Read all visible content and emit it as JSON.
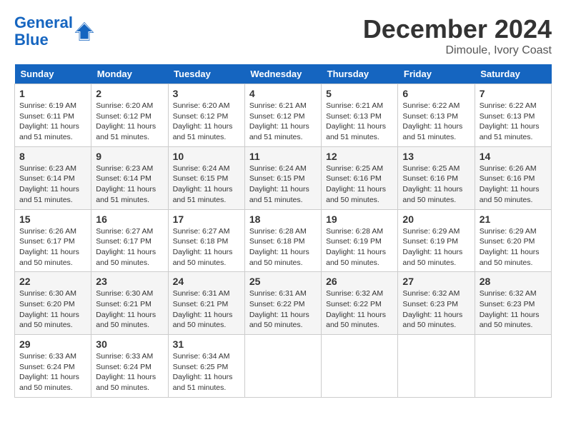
{
  "header": {
    "logo_line1": "General",
    "logo_line2": "Blue",
    "month": "December 2024",
    "location": "Dimoule, Ivory Coast"
  },
  "weekdays": [
    "Sunday",
    "Monday",
    "Tuesday",
    "Wednesday",
    "Thursday",
    "Friday",
    "Saturday"
  ],
  "weeks": [
    [
      {
        "day": "1",
        "rise": "6:19 AM",
        "set": "6:11 PM",
        "hours": "11 hours and 51 minutes."
      },
      {
        "day": "2",
        "rise": "6:20 AM",
        "set": "6:12 PM",
        "hours": "11 hours and 51 minutes."
      },
      {
        "day": "3",
        "rise": "6:20 AM",
        "set": "6:12 PM",
        "hours": "11 hours and 51 minutes."
      },
      {
        "day": "4",
        "rise": "6:21 AM",
        "set": "6:12 PM",
        "hours": "11 hours and 51 minutes."
      },
      {
        "day": "5",
        "rise": "6:21 AM",
        "set": "6:13 PM",
        "hours": "11 hours and 51 minutes."
      },
      {
        "day": "6",
        "rise": "6:22 AM",
        "set": "6:13 PM",
        "hours": "11 hours and 51 minutes."
      },
      {
        "day": "7",
        "rise": "6:22 AM",
        "set": "6:13 PM",
        "hours": "11 hours and 51 minutes."
      }
    ],
    [
      {
        "day": "8",
        "rise": "6:23 AM",
        "set": "6:14 PM",
        "hours": "11 hours and 51 minutes."
      },
      {
        "day": "9",
        "rise": "6:23 AM",
        "set": "6:14 PM",
        "hours": "11 hours and 51 minutes."
      },
      {
        "day": "10",
        "rise": "6:24 AM",
        "set": "6:15 PM",
        "hours": "11 hours and 51 minutes."
      },
      {
        "day": "11",
        "rise": "6:24 AM",
        "set": "6:15 PM",
        "hours": "11 hours and 51 minutes."
      },
      {
        "day": "12",
        "rise": "6:25 AM",
        "set": "6:16 PM",
        "hours": "11 hours and 50 minutes."
      },
      {
        "day": "13",
        "rise": "6:25 AM",
        "set": "6:16 PM",
        "hours": "11 hours and 50 minutes."
      },
      {
        "day": "14",
        "rise": "6:26 AM",
        "set": "6:16 PM",
        "hours": "11 hours and 50 minutes."
      }
    ],
    [
      {
        "day": "15",
        "rise": "6:26 AM",
        "set": "6:17 PM",
        "hours": "11 hours and 50 minutes."
      },
      {
        "day": "16",
        "rise": "6:27 AM",
        "set": "6:17 PM",
        "hours": "11 hours and 50 minutes."
      },
      {
        "day": "17",
        "rise": "6:27 AM",
        "set": "6:18 PM",
        "hours": "11 hours and 50 minutes."
      },
      {
        "day": "18",
        "rise": "6:28 AM",
        "set": "6:18 PM",
        "hours": "11 hours and 50 minutes."
      },
      {
        "day": "19",
        "rise": "6:28 AM",
        "set": "6:19 PM",
        "hours": "11 hours and 50 minutes."
      },
      {
        "day": "20",
        "rise": "6:29 AM",
        "set": "6:19 PM",
        "hours": "11 hours and 50 minutes."
      },
      {
        "day": "21",
        "rise": "6:29 AM",
        "set": "6:20 PM",
        "hours": "11 hours and 50 minutes."
      }
    ],
    [
      {
        "day": "22",
        "rise": "6:30 AM",
        "set": "6:20 PM",
        "hours": "11 hours and 50 minutes."
      },
      {
        "day": "23",
        "rise": "6:30 AM",
        "set": "6:21 PM",
        "hours": "11 hours and 50 minutes."
      },
      {
        "day": "24",
        "rise": "6:31 AM",
        "set": "6:21 PM",
        "hours": "11 hours and 50 minutes."
      },
      {
        "day": "25",
        "rise": "6:31 AM",
        "set": "6:22 PM",
        "hours": "11 hours and 50 minutes."
      },
      {
        "day": "26",
        "rise": "6:32 AM",
        "set": "6:22 PM",
        "hours": "11 hours and 50 minutes."
      },
      {
        "day": "27",
        "rise": "6:32 AM",
        "set": "6:23 PM",
        "hours": "11 hours and 50 minutes."
      },
      {
        "day": "28",
        "rise": "6:32 AM",
        "set": "6:23 PM",
        "hours": "11 hours and 50 minutes."
      }
    ],
    [
      {
        "day": "29",
        "rise": "6:33 AM",
        "set": "6:24 PM",
        "hours": "11 hours and 50 minutes."
      },
      {
        "day": "30",
        "rise": "6:33 AM",
        "set": "6:24 PM",
        "hours": "11 hours and 50 minutes."
      },
      {
        "day": "31",
        "rise": "6:34 AM",
        "set": "6:25 PM",
        "hours": "11 hours and 51 minutes."
      },
      null,
      null,
      null,
      null
    ]
  ],
  "labels": {
    "sunrise": "Sunrise:",
    "sunset": "Sunset:",
    "daylight": "Daylight:"
  }
}
